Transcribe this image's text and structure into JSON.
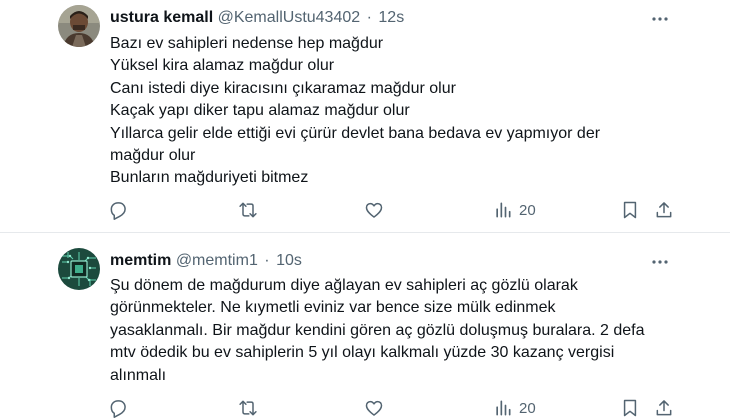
{
  "tweets": [
    {
      "name": "ustura kemall",
      "handle": "@KemallUstu43402",
      "separator": "·",
      "time": "12s",
      "lines": [
        "Bazı ev sahipleri nedense hep mağdur",
        "Yüksel kira alamaz mağdur olur",
        "Canı istedi diye kiracısını çıkaramaz mağdur olur",
        "Kaçak yapı diker tapu alamaz mağdur olur",
        "Yıllarca gelir elde ettiği evi çürür devlet bana bedava ev yapmıyor der",
        "mağdur olur",
        "Bunların mağduriyeti bitmez"
      ],
      "views": "20",
      "avatar_icon": "man-photo-avatar"
    },
    {
      "name": "memtim",
      "handle": "@memtim1",
      "separator": "·",
      "time": "10s",
      "lines": [
        "Şu dönem de mağdurum diye ağlayan ev sahipleri aç gözlü olarak",
        "görünmekteler. Ne kıymetli eviniz var bence size mülk edinmek",
        "yasaklanmalı. Bir mağdur kendini gören aç gözlü doluşmuş buralara. 2 defa",
        "mtv ödedik bu ev sahiplerin 5 yıl olayı kalkmalı yüzde 30 kazanç vergisi",
        "alınmalı"
      ],
      "views": "20",
      "avatar_icon": "circuit-chip-avatar"
    }
  ],
  "colors": {
    "text": "#0f1419",
    "secondary": "#536471",
    "divider": "#e6e9ec",
    "avatar2_bg": "#1c4a3d"
  },
  "icons": [
    "more-icon",
    "reply-icon",
    "retweet-icon",
    "like-icon",
    "views-icon",
    "bookmark-icon",
    "share-icon"
  ]
}
